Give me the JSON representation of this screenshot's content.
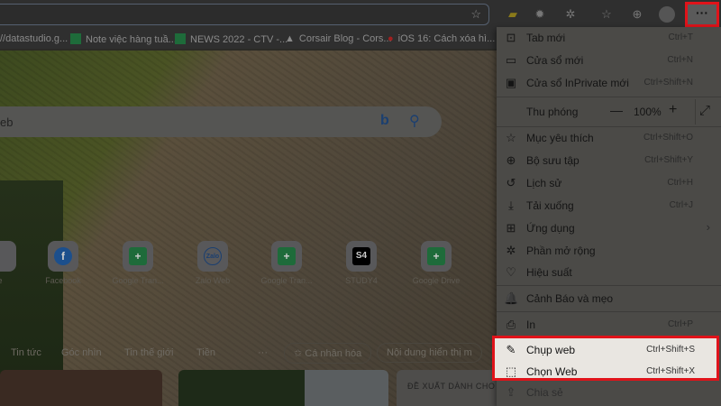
{
  "toolbar": {
    "more_label": "···",
    "favorites_icon": "star-add-icon"
  },
  "bookmarks": [
    {
      "label": "//datastudio.g..."
    },
    {
      "label": "Note việc hàng tuầ..."
    },
    {
      "label": "NEWS 2022 - CTV -..."
    },
    {
      "label": "Corsair Blog - Cors..."
    },
    {
      "label": "iOS 16: Cách xóa hì..."
    }
  ],
  "search": {
    "placeholder": "eb",
    "bing": "b"
  },
  "shortcuts": [
    {
      "label": "e",
      "icon": ""
    },
    {
      "label": "Facebook",
      "icon": "f"
    },
    {
      "label": "Google Tran...",
      "icon": "+"
    },
    {
      "label": "Zalo Web",
      "icon": "Zalo"
    },
    {
      "label": "Google Tran...",
      "icon": "+"
    },
    {
      "label": "STUDY4",
      "icon": "S4"
    },
    {
      "label": "Google Drive",
      "icon": "+"
    }
  ],
  "news": {
    "tabs": [
      "Tin tức",
      "Góc nhìn",
      "Tin thế giới",
      "Tiền"
    ],
    "more": "···",
    "personalize": "Cá nhân hóa",
    "content": "Nội dung hiển thị m",
    "suggest": "ĐỀ XUẤT DÀNH CHO"
  },
  "menu": {
    "items": [
      {
        "label": "Tab mới",
        "shortcut": "Ctrl+T",
        "icon": "⊡"
      },
      {
        "label": "Cửa sổ mới",
        "shortcut": "Ctrl+N",
        "icon": "▭"
      },
      {
        "label": "Cửa sổ InPrivate mới",
        "shortcut": "Ctrl+Shift+N",
        "icon": "▣"
      },
      {
        "label": "Mục yêu thích",
        "shortcut": "Ctrl+Shift+O",
        "icon": "☆"
      },
      {
        "label": "Bộ sưu tập",
        "shortcut": "Ctrl+Shift+Y",
        "icon": "⊕"
      },
      {
        "label": "Lịch sử",
        "shortcut": "Ctrl+H",
        "icon": "↺"
      },
      {
        "label": "Tải xuống",
        "shortcut": "Ctrl+J",
        "icon": "⤓"
      },
      {
        "label": "Ứng dụng",
        "shortcut": "›",
        "icon": "⊞"
      },
      {
        "label": "Phần mở rộng",
        "shortcut": "",
        "icon": "✲"
      },
      {
        "label": "Hiệu suất",
        "shortcut": "",
        "icon": "♡"
      },
      {
        "label": "Cảnh Báo và mẹo",
        "shortcut": "",
        "icon": "🔔"
      },
      {
        "label": "In",
        "shortcut": "Ctrl+P",
        "icon": "⎙"
      },
      {
        "label": "Chụp web",
        "shortcut": "Ctrl+Shift+S",
        "icon": "✎"
      },
      {
        "label": "Chọn Web",
        "shortcut": "Ctrl+Shift+X",
        "icon": "⬚"
      },
      {
        "label": "Chia sẻ",
        "shortcut": "",
        "icon": "⇪"
      }
    ],
    "zoom": {
      "label": "Thu phóng",
      "value": "100%",
      "minus": "—",
      "plus": "+",
      "fullscreen": "⤢"
    }
  },
  "colors": {
    "highlight_border": "#e0131a"
  }
}
